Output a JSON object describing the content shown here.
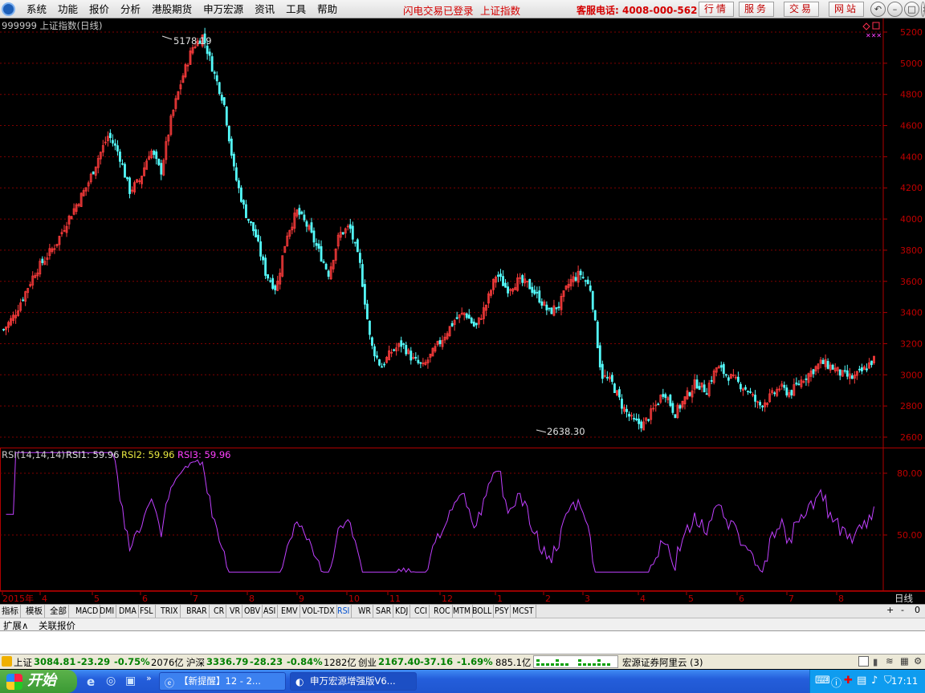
{
  "menubar": {
    "items": [
      "系统",
      "功能",
      "报价",
      "分析",
      "港股期货",
      "申万宏源",
      "资讯",
      "工具",
      "帮助"
    ],
    "login_status": "闪电交易已登录",
    "index_name": "上证指数",
    "hotline": "客服电话: 4008-000-562",
    "buttons": [
      "行情",
      "服务",
      "交易",
      "网站"
    ],
    "window_controls": [
      "back-icon",
      "minimize-icon",
      "maximize-icon",
      "close-icon"
    ]
  },
  "chart": {
    "title": "999999 上证指数(日线)",
    "high_label": "5178.19",
    "low_label": "2638.30",
    "price_ticks": [
      "5200",
      "5000",
      "4800",
      "4600",
      "4400",
      "4200",
      "4000",
      "3800",
      "3600",
      "3400",
      "3200",
      "3000",
      "2800",
      "2600"
    ],
    "rsi_title": "RSI(14,14,14)",
    "rsi1_label": "RSI1: 59.96",
    "rsi2_label": "RSI2: 59.96",
    "rsi3_label": "RSI3: 59.96",
    "rsi_ticks": [
      "80.00",
      "50.00"
    ],
    "period_label": "日线",
    "x_labels": [
      {
        "t": "2015年"
      },
      {
        "t": "4"
      },
      {
        "t": "5"
      },
      {
        "t": "6"
      },
      {
        "t": "7"
      },
      {
        "t": "8"
      },
      {
        "t": "9"
      },
      {
        "t": "10"
      },
      {
        "t": "11"
      },
      {
        "t": "12"
      },
      {
        "t": "1"
      },
      {
        "t": "2"
      },
      {
        "t": "3"
      },
      {
        "t": "4"
      },
      {
        "t": "5"
      },
      {
        "t": "6"
      },
      {
        "t": "7"
      },
      {
        "t": "8"
      }
    ],
    "colors": {
      "up": "#ff3c3c",
      "down": "#54fcfc",
      "rsi": "#c040ff",
      "grid": "#800000",
      "axis_text": "#c00000"
    }
  },
  "chart_data": {
    "type": "candlestick",
    "title": "999999 上证指数(日线)",
    "ylim": [
      2600,
      5250
    ],
    "close_series": [
      3290,
      3380,
      3520,
      3660,
      3750,
      3840,
      3980,
      4100,
      4220,
      4390,
      4540,
      4420,
      4180,
      4250,
      4450,
      4300,
      4650,
      4900,
      5100,
      5178,
      4950,
      4750,
      4300,
      4050,
      3900,
      3650,
      3550,
      3900,
      4050,
      3950,
      3800,
      3650,
      3900,
      3950,
      3700,
      3200,
      3050,
      3150,
      3200,
      3100,
      3050,
      3150,
      3250,
      3350,
      3400,
      3300,
      3450,
      3650,
      3550,
      3600,
      3580,
      3500,
      3400,
      3450,
      3600,
      3650,
      3550,
      3000,
      2950,
      2800,
      2700,
      2680,
      2780,
      2900,
      2750,
      2850,
      2950,
      2900,
      3050,
      3000,
      2950,
      2900,
      2800,
      2850,
      2920,
      2880,
      2960,
      3020,
      3080,
      3050,
      3000,
      2980,
      3030,
      3100
    ]
  },
  "indicator_tabs": [
    "指标",
    "模板",
    "全部",
    "MACD",
    "DMI",
    "DMA",
    "FSL",
    "TRIX",
    "BRAR",
    "CR",
    "VR",
    "OBV",
    "ASI",
    "EMV",
    "VOL-TDX",
    "RSI",
    "WR",
    "SAR",
    "KDJ",
    "CCI",
    "ROC",
    "MTM",
    "BOLL",
    "PSY",
    "MCST"
  ],
  "tab_controls": [
    "+",
    "-",
    "0"
  ],
  "sub_tabs": [
    "扩展∧",
    "关联报价"
  ],
  "status": {
    "sh_name": "上证",
    "sh_value": "3084.81",
    "sh_change": "-23.29",
    "sh_pct": "-0.75%",
    "sh_amount": "2076亿",
    "hs_name": "沪深",
    "hs_value": "3336.79",
    "hs_change": "-28.23",
    "hs_pct": "-0.84%",
    "hs_amount": "1282亿",
    "cy_name": "创业",
    "cy_value": "2167.40",
    "cy_change": "-37.16",
    "cy_pct": "-1.69%",
    "cy_amount": "885.1亿",
    "broker": "宏源证券阿里云 (3)"
  },
  "taskbar": {
    "start": "开始",
    "tasks": [
      "【新提醒】12 - 2...",
      "申万宏源增强版V6..."
    ],
    "clock": "17:11"
  }
}
